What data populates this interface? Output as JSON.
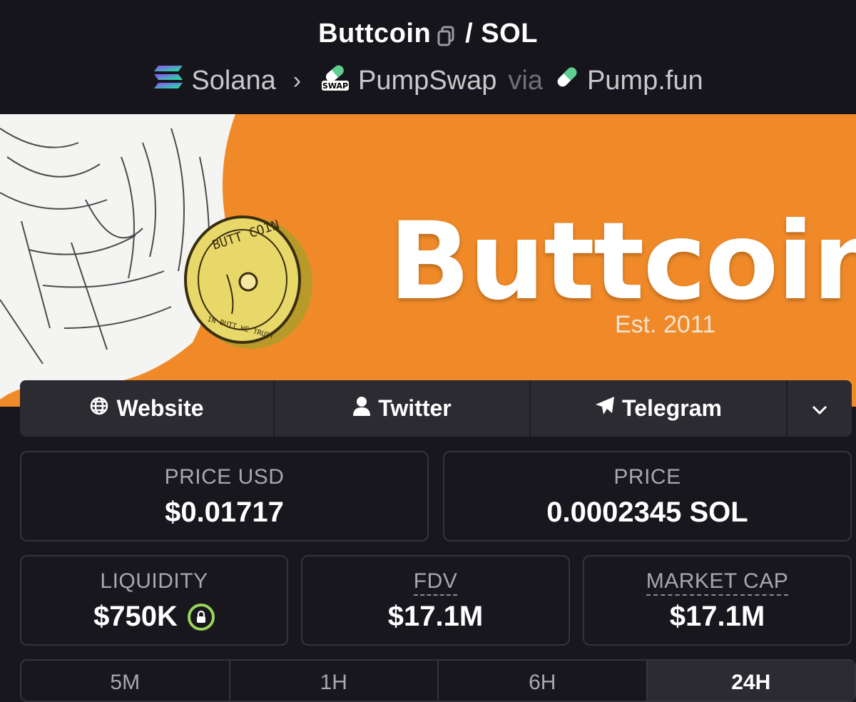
{
  "header": {
    "token_name": "Buttcoin",
    "pair_suffix": "/ SOL",
    "chain": "Solana",
    "dex": "PumpSwap",
    "dex_badge": "SWAP",
    "via": "via",
    "launchpad": "Pump.fun"
  },
  "banner": {
    "title": "Buttcoin",
    "subtitle": "Est. 2011",
    "coin_top": "BUTT COIN",
    "coin_bottom": "IN BUTT WE TRUST"
  },
  "links": {
    "website": "Website",
    "twitter": "Twitter",
    "telegram": "Telegram"
  },
  "stats": {
    "price_usd_label": "PRICE USD",
    "price_usd": "$0.01717",
    "price_label": "PRICE",
    "price": "0.0002345 SOL",
    "liquidity_label": "LIQUIDITY",
    "liquidity": "$750K",
    "fdv_label": "FDV",
    "fdv": "$17.1M",
    "mcap_label": "MARKET CAP",
    "mcap": "$17.1M"
  },
  "timeframes": [
    "5M",
    "1H",
    "6H",
    "24H"
  ],
  "colors": {
    "background": "#18171d",
    "banner_orange": "#f08a29",
    "lock_green": "#9bd45b",
    "pump_green": "#5fcf8f"
  }
}
